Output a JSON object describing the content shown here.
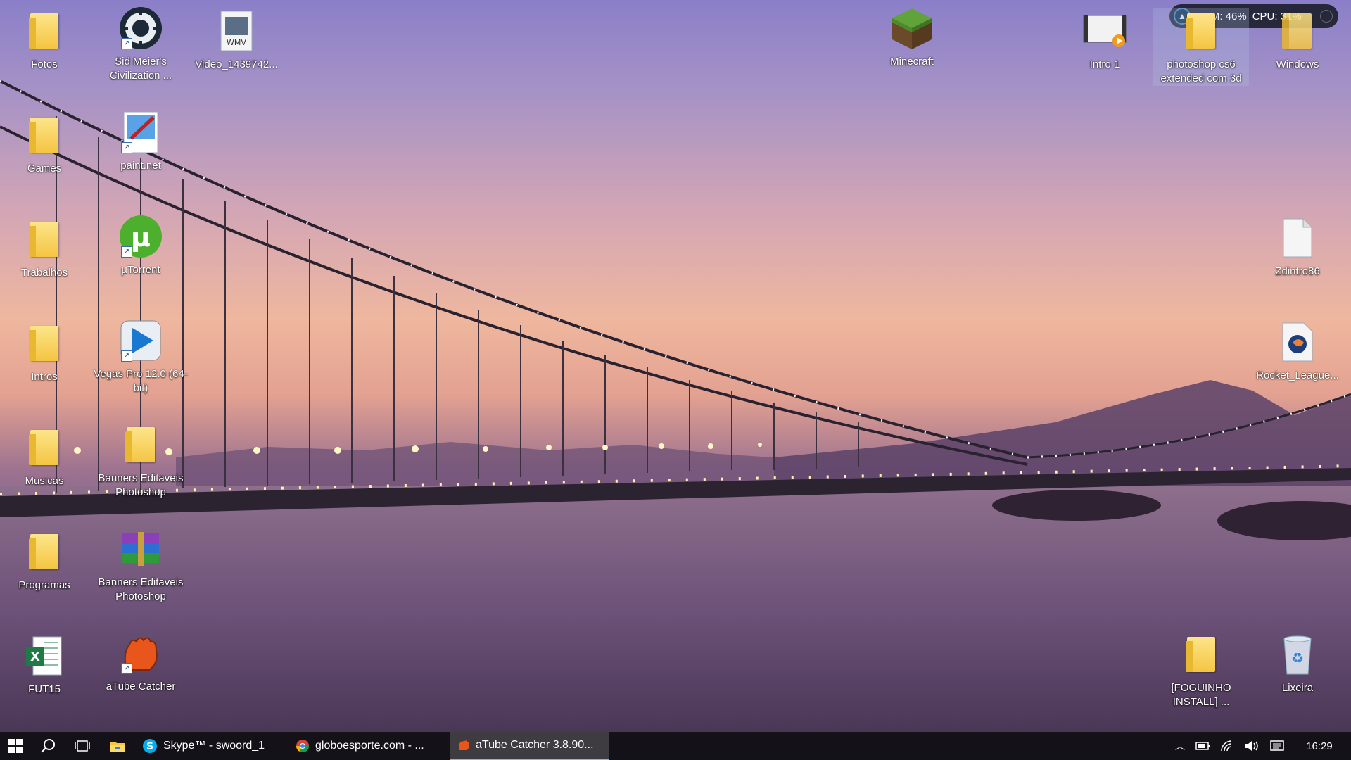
{
  "resource_monitor": {
    "ram": "RAM: 46%",
    "cpu": "CPU: 31%"
  },
  "desktop": {
    "icons": {
      "fotos": "Fotos",
      "civilization": "Sid Meier's Civilization ...",
      "video": "Video_1439742...",
      "minecraft": "Minecraft",
      "intro1": "Intro 1",
      "photoshop": "photoshop cs6 extended com 3d",
      "windows": "Windows",
      "games": "Games",
      "paintnet": "paint.net",
      "trabalhos": "Trabalhos",
      "utorrent": "µTorrent",
      "zdintro": "Zdintro86",
      "intros": "Intros",
      "vegas": "Vegas Pro 12.0 (64-bit)",
      "rocket": "Rocket_League...",
      "musicas": "Musicas",
      "banners1": "Banners Editaveis Photoshop",
      "programas": "Programas",
      "banners2": "Banners Editaveis Photoshop",
      "fut15": "FUT15",
      "atube": "aTube Catcher",
      "foguinho": "[FOGUINHO INSTALL] ...",
      "lixeira": "Lixeira"
    }
  },
  "taskbar": {
    "tasks": {
      "skype": "Skype™ - swoord_1",
      "chrome": "globoesporte.com - ...",
      "atube": "aTube Catcher 3.8.90..."
    },
    "clock": "16:29"
  }
}
